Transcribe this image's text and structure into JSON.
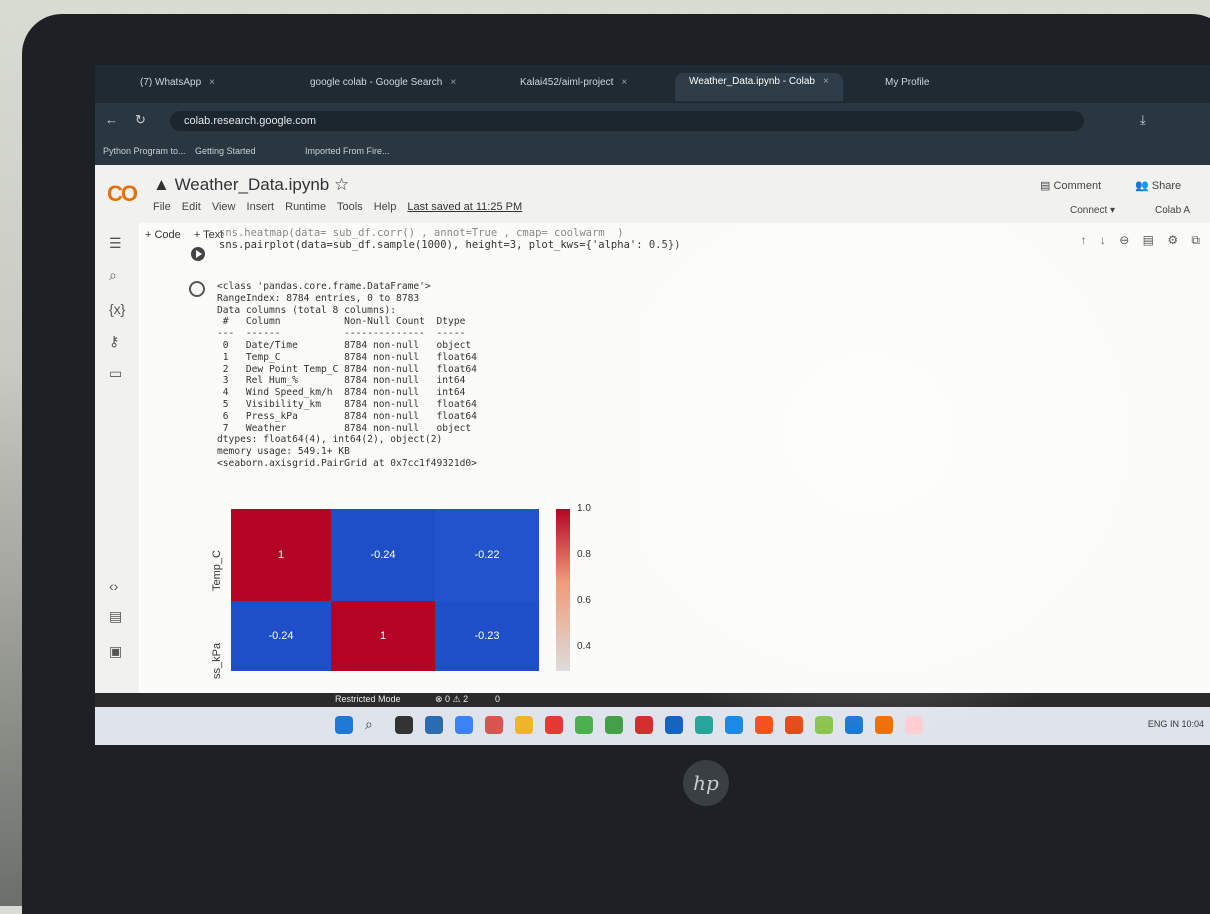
{
  "browser": {
    "tabs": [
      {
        "label": "(7) WhatsApp"
      },
      {
        "label": "google colab - Google Search"
      },
      {
        "label": "Kalai452/aiml-project"
      },
      {
        "label": "Weather_Data.ipynb - Colab"
      },
      {
        "label": "My Profile"
      }
    ],
    "url": "colab.research.google.com",
    "bookmarks": [
      "Python Program to...",
      "Getting Started",
      "Imported From Fire..."
    ]
  },
  "colab": {
    "title": "Weather_Data.ipynb",
    "menu": [
      "File",
      "Edit",
      "View",
      "Insert",
      "Runtime",
      "Tools",
      "Help"
    ],
    "last_saved": "Last saved at 11:25 PM",
    "comment": "Comment",
    "share": "Share",
    "connect": "Connect",
    "colab_ai": "Colab A",
    "add_code": "+ Code",
    "add_text": "+ Text"
  },
  "cell": {
    "code_line1": "sns.heatmap(data= sub_df.corr() , annot=True , cmap= coolwarm  )",
    "code_line2": "sns.pairplot(data=sub_df.sample(1000), height=3, plot_kws={'alpha': 0.5})"
  },
  "output": {
    "text": "<class 'pandas.core.frame.DataFrame'>\nRangeIndex: 8784 entries, 0 to 8783\nData columns (total 8 columns):\n #   Column           Non-Null Count  Dtype\n---  ------           --------------  -----\n 0   Date/Time        8784 non-null   object\n 1   Temp_C           8784 non-null   float64\n 2   Dew Point Temp_C 8784 non-null   float64\n 3   Rel Hum_%        8784 non-null   int64\n 4   Wind Speed_km/h  8784 non-null   int64\n 5   Visibility_km    8784 non-null   float64\n 6   Press_kPa        8784 non-null   float64\n 7   Weather          8784 non-null   object\ndtypes: float64(4), int64(2), object(2)\nmemory usage: 549.1+ KB\n<seaborn.axisgrid.PairGrid at 0x7cc1f49321d0>"
  },
  "chart_data": {
    "type": "heatmap",
    "row_labels": [
      "Temp_C",
      "ss_kPa"
    ],
    "cells": [
      [
        1,
        -0.24,
        -0.22
      ],
      [
        -0.24,
        1,
        -0.23
      ]
    ],
    "cell_labels": [
      [
        "1",
        "-0.24",
        "-0.22"
      ],
      [
        "-0.24",
        "1",
        "-0.23"
      ]
    ],
    "colorbar_ticks": [
      "1.0",
      "0.8",
      "0.6",
      "0.4"
    ],
    "colormap": "coolwarm",
    "colors": {
      "high": "#b40426",
      "low": "#1f4fc8"
    }
  },
  "statusbar": {
    "restricted": "Restricted Mode",
    "counts": "⊗ 0 ⚠ 2",
    "ports": "0"
  },
  "taskbar": {
    "lang": "ENG",
    "region": "IN",
    "time": "10:04"
  },
  "hp": "hp"
}
